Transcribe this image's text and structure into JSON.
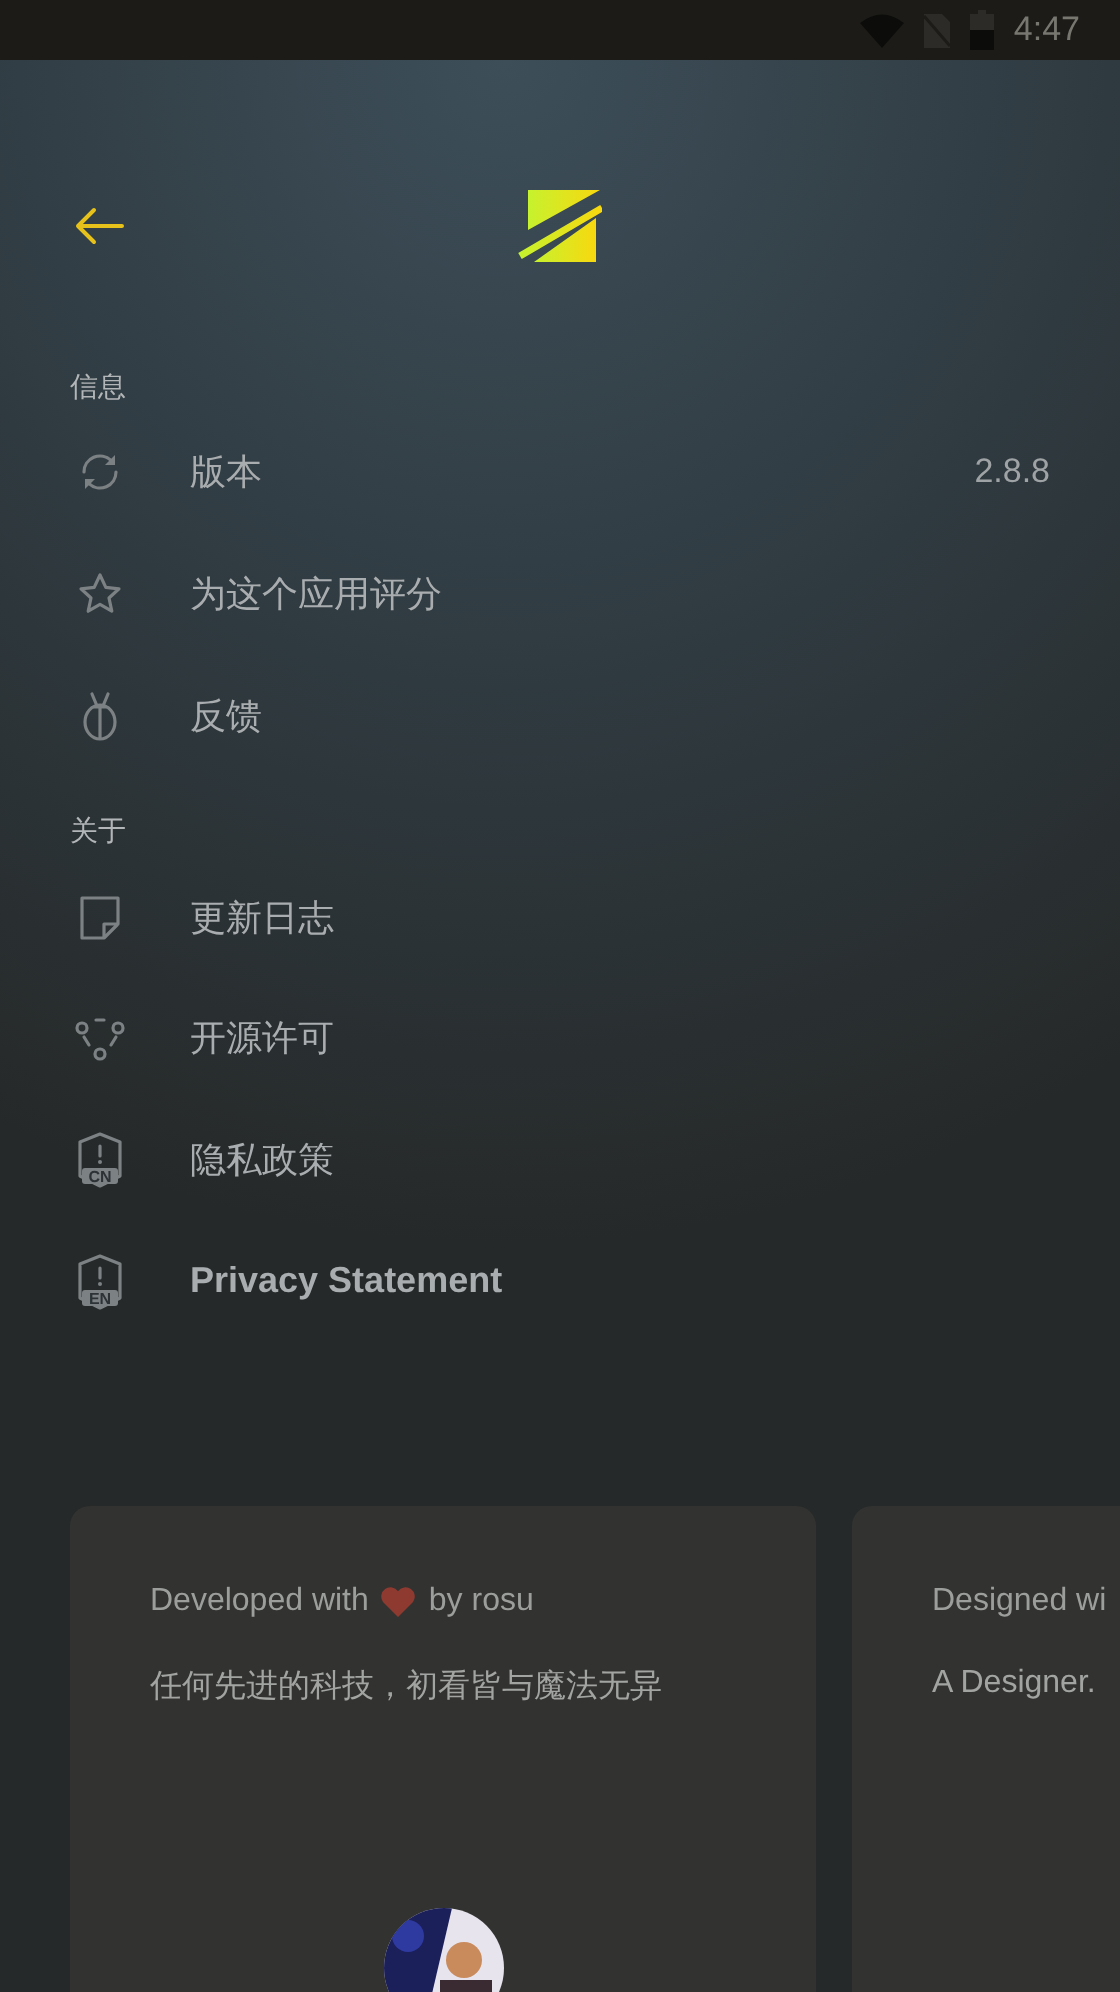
{
  "status_bar": {
    "time": "4:47"
  },
  "sections": [
    {
      "title": "信息",
      "items": [
        {
          "label": "版本",
          "value": "2.8.8"
        },
        {
          "label": "为这个应用评分"
        },
        {
          "label": "反馈"
        }
      ]
    },
    {
      "title": "关于",
      "items": [
        {
          "label": "更新日志"
        },
        {
          "label": "开源许可"
        },
        {
          "label": "隐私政策",
          "badge": "CN"
        },
        {
          "label": "Privacy Statement",
          "badge": "EN"
        }
      ]
    }
  ],
  "cards": [
    {
      "credit_prefix": "Developed with",
      "credit_suffix": "by rosu",
      "text": "任何先进的科技，初看皆与魔法无异"
    },
    {
      "credit_prefix": "Designed wi",
      "text": "A Designer."
    }
  ]
}
